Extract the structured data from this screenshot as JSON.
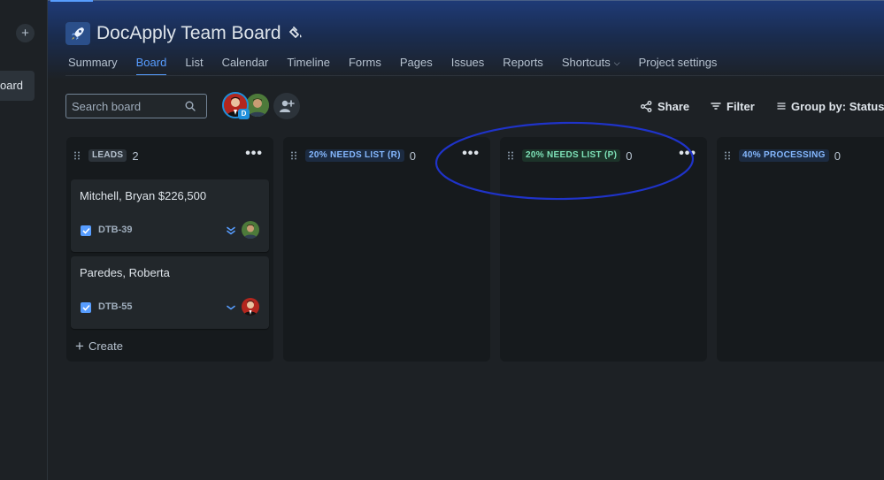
{
  "sidebar": {
    "add_label": "+",
    "nav_item_label": "oard"
  },
  "project": {
    "title": "DocApply Team Board"
  },
  "tabs": [
    {
      "label": "Summary"
    },
    {
      "label": "Board",
      "active": true
    },
    {
      "label": "List"
    },
    {
      "label": "Calendar"
    },
    {
      "label": "Timeline"
    },
    {
      "label": "Forms"
    },
    {
      "label": "Pages"
    },
    {
      "label": "Issues"
    },
    {
      "label": "Reports"
    },
    {
      "label": "Shortcuts"
    },
    {
      "label": "Project settings"
    }
  ],
  "toolbar": {
    "search_placeholder": "Search board",
    "avatar_badge": "D",
    "share_label": "Share",
    "filter_label": "Filter",
    "group_label": "Group by: Status"
  },
  "columns": [
    {
      "status": "LEADS",
      "count": "2",
      "lozenge_color": "gray",
      "cards": [
        {
          "title": "Mitchell, Bryan $226,500",
          "key": "DTB-39",
          "priority": "low",
          "priority_icon": "double-chevron-down-icon"
        },
        {
          "title": "Paredes, Roberta",
          "key": "DTB-55",
          "priority": "lowest",
          "priority_icon": "chevron-down-icon"
        }
      ],
      "create_label": "Create"
    },
    {
      "status": "20% NEEDS LIST (R)",
      "count": "0",
      "lozenge_color": "blue"
    },
    {
      "status": "20% NEEDS LIST (P)",
      "count": "0",
      "lozenge_color": "green"
    },
    {
      "status": "40% PROCESSING",
      "count": "0",
      "lozenge_color": "blue"
    }
  ],
  "colors": {
    "accent": "#579dff",
    "background": "#1d2125",
    "column_bg": "#161a1d",
    "annotation_ellipse": "#1f33c9"
  }
}
